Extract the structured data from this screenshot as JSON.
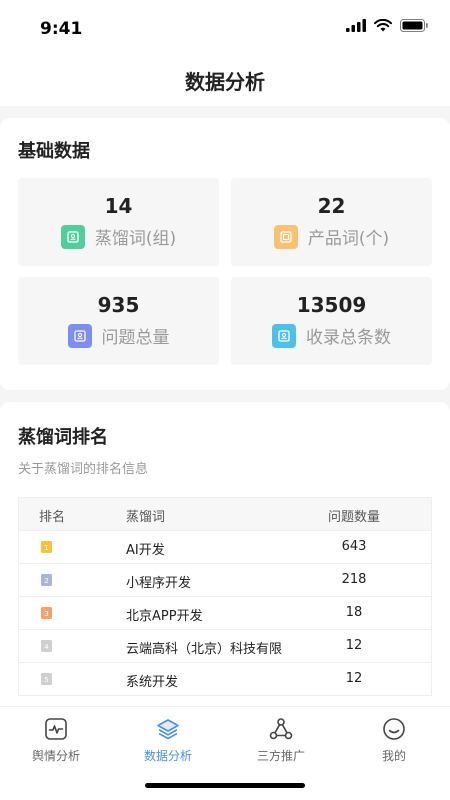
{
  "status": {
    "time": "9:41"
  },
  "nav": {
    "title": "数据分析"
  },
  "basic": {
    "title": "基础数据",
    "stats": [
      {
        "value": "14",
        "label": "蒸馏词(组)",
        "color": "#4ecf9c"
      },
      {
        "value": "22",
        "label": "产品词(个)",
        "color": "#f8c272"
      },
      {
        "value": "935",
        "label": "问题总量",
        "color": "#7b8ef5"
      },
      {
        "value": "13509",
        "label": "收录总条数",
        "color": "#4cc1ee"
      }
    ]
  },
  "ranking": {
    "title": "蒸馏词排名",
    "subtitle": "关于蒸馏词的排名信息",
    "headers": {
      "rank": "排名",
      "word": "蒸馏词",
      "count": "问题数量"
    },
    "rows": [
      {
        "rank": "1",
        "word": "AI开发",
        "count": "643",
        "medal_color": "#f5c23a"
      },
      {
        "rank": "2",
        "word": "小程序开发",
        "count": "218",
        "medal_color": "#a9b4d6"
      },
      {
        "rank": "3",
        "word": "北京APP开发",
        "count": "18",
        "medal_color": "#f3a26a"
      },
      {
        "rank": "4",
        "word": "云端高科（北京）科技有限",
        "count": "12",
        "medal_color": "#cfcfcf"
      },
      {
        "rank": "5",
        "word": "系统开发",
        "count": "12",
        "medal_color": "#cfcfcf"
      }
    ]
  },
  "tabs": [
    {
      "label": "舆情分析",
      "icon": "monitor-icon",
      "active": false
    },
    {
      "label": "数据分析",
      "icon": "layers-icon",
      "active": true
    },
    {
      "label": "三方推广",
      "icon": "share-icon",
      "active": false
    },
    {
      "label": "我的",
      "icon": "smile-icon",
      "active": false
    }
  ],
  "colors": {
    "accent": "#4a8ef0"
  }
}
